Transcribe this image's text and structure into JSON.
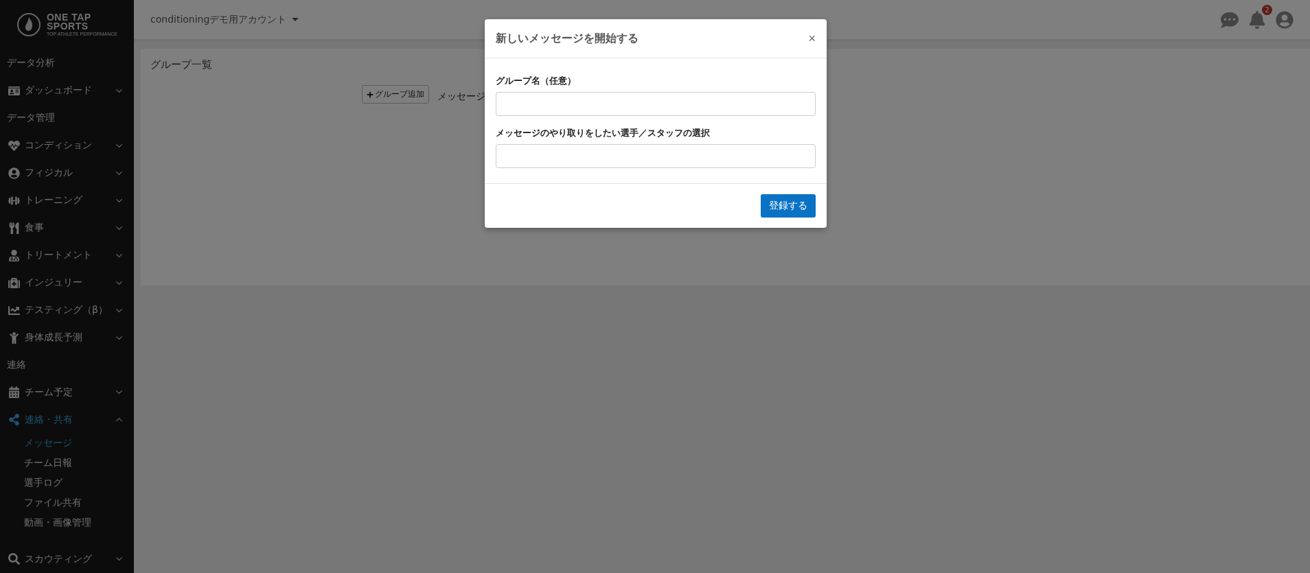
{
  "logo": {
    "line_1": "ONE TAP",
    "line_2": "SPORTS",
    "tagline": "TOP ATHLETE PERFORMANCE"
  },
  "sidebar": {
    "items": [
      {
        "kind": "heading",
        "label": "データ分析"
      },
      {
        "kind": "menu",
        "label": "ダッシュボード",
        "expanded": false,
        "selected": false
      },
      {
        "kind": "heading",
        "label": "データ管理"
      },
      {
        "kind": "menu",
        "label": "コンディション",
        "expanded": false,
        "selected": false
      },
      {
        "kind": "menu",
        "label": "フィジカル",
        "expanded": false,
        "selected": false
      },
      {
        "kind": "menu",
        "label": "トレーニング",
        "expanded": false,
        "selected": false
      },
      {
        "kind": "menu",
        "label": "食事",
        "expanded": false,
        "selected": false
      },
      {
        "kind": "menu",
        "label": "トリートメント",
        "expanded": false,
        "selected": false
      },
      {
        "kind": "menu",
        "label": "インジュリー",
        "expanded": false,
        "selected": false
      },
      {
        "kind": "menu",
        "label": "テスティング（β）",
        "expanded": false,
        "selected": false
      },
      {
        "kind": "menu",
        "label": "身体成長予測",
        "expanded": false,
        "selected": false
      },
      {
        "kind": "heading",
        "label": "連絡"
      },
      {
        "kind": "menu",
        "label": "チーム予定",
        "expanded": false,
        "selected": false
      },
      {
        "kind": "menu",
        "label": "連絡・共有",
        "expanded": true,
        "selected": true,
        "children": [
          {
            "label": "メッセージ",
            "selected": true
          },
          {
            "label": "チーム日報",
            "selected": false
          },
          {
            "label": "選手ログ",
            "selected": false
          },
          {
            "label": "ファイル共有",
            "selected": false
          },
          {
            "label": "動画・画像管理",
            "selected": false
          }
        ]
      },
      {
        "kind": "menu",
        "label": "スカウティング",
        "expanded": false,
        "selected": false
      }
    ]
  },
  "header": {
    "account": "conditioningデモ用アカウント",
    "notification_count": "2"
  },
  "panel": {
    "title": "グループ一覧",
    "add_button": "グループ追加",
    "text": "メッセージ"
  },
  "modal": {
    "title": "新しいメッセージを開始する",
    "close": "×",
    "fields": [
      {
        "label": "グループ名（任意）"
      },
      {
        "label": "メッセージのやり取りをしたい選手／スタッフの選択"
      }
    ],
    "submit": "登録する"
  }
}
